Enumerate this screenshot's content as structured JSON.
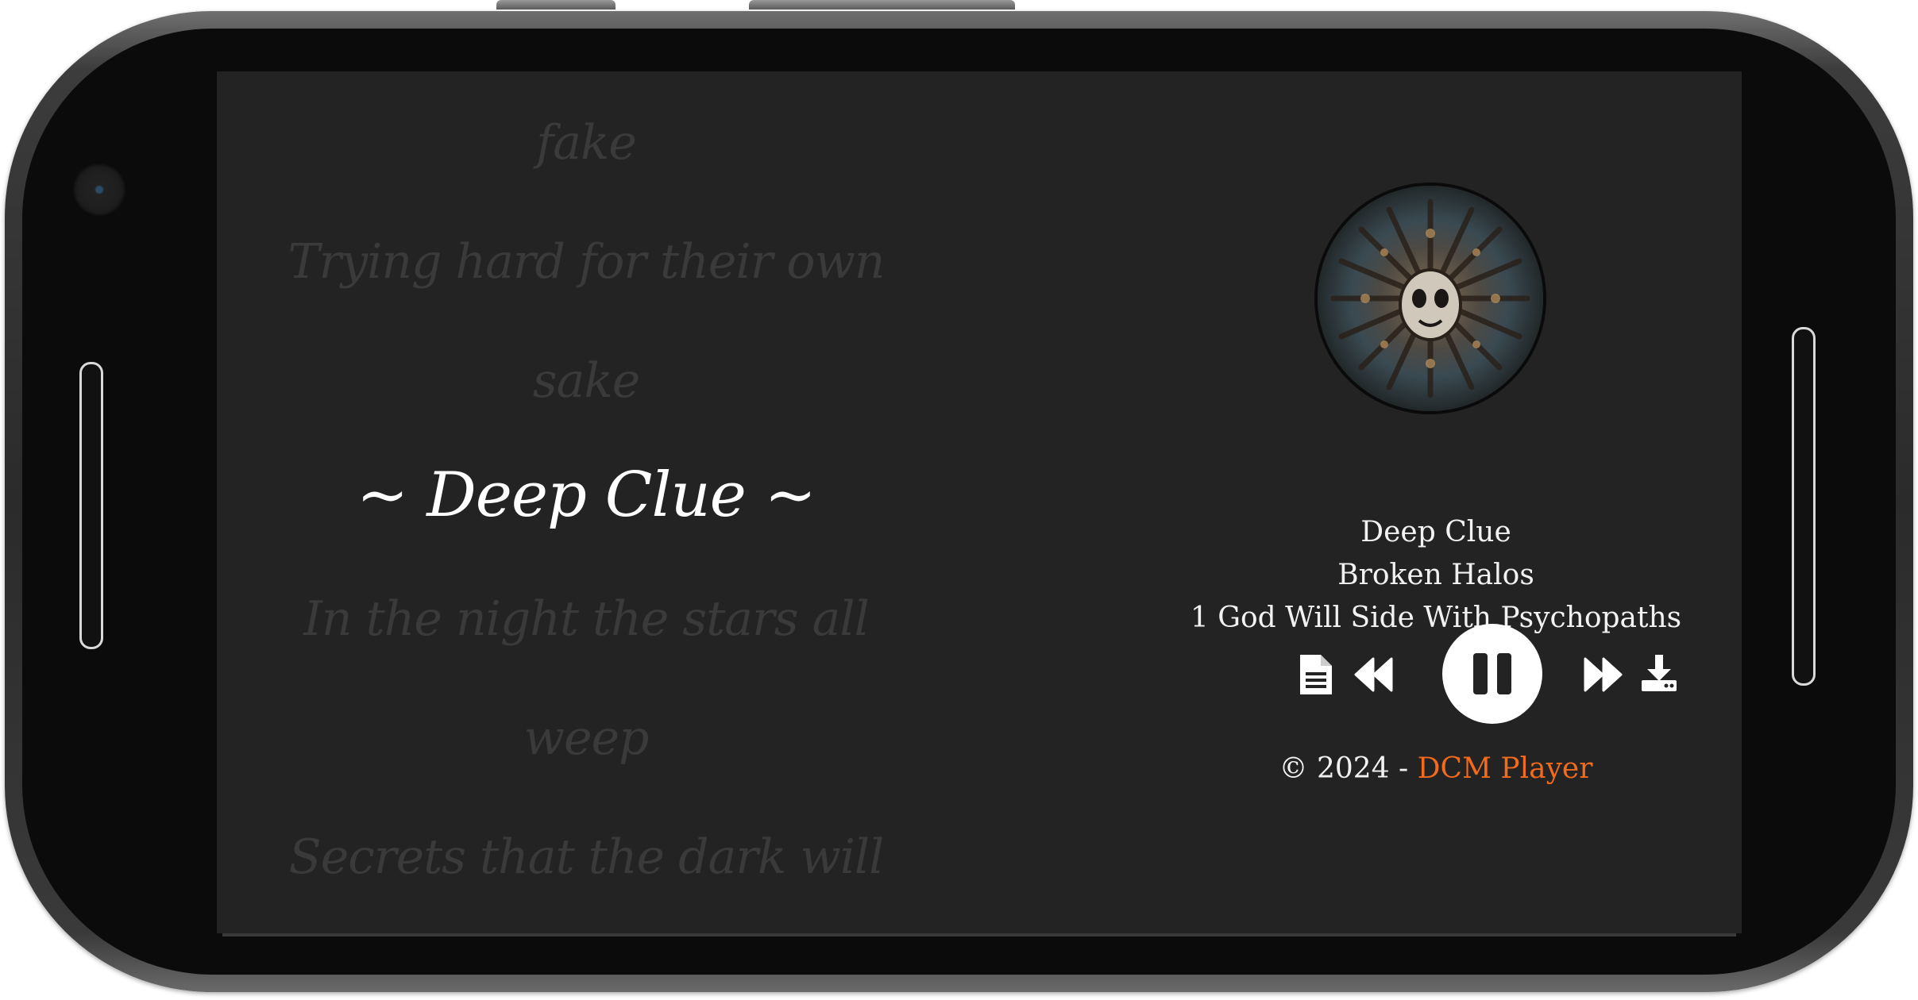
{
  "colors": {
    "screen_background": "#232323",
    "lyric_inactive": "#3a3a3a",
    "lyric_active": "#ffffff",
    "text": "#f2f2f2",
    "brand": "#f26a1b",
    "play_button": "#ffffff"
  },
  "lyrics": {
    "lines": [
      "fake",
      "Trying hard for their own",
      "sake",
      "~ Deep Clue ~",
      "In the night the stars all",
      "weep",
      "Secrets that the dark will"
    ],
    "active_index": 3
  },
  "track": {
    "title": "Deep Clue",
    "artist": "Broken Halos",
    "album": "1 God Will Side With Psychopaths",
    "cover_art": "album-cover-image",
    "is_playing": true
  },
  "controls": {
    "lyrics_icon": "document-icon",
    "previous_icon": "rewind-icon",
    "play_pause_icon": "pause-icon",
    "next_icon": "fast-forward-icon",
    "download_icon": "download-icon"
  },
  "footer": {
    "copyright": "© 2024 - ",
    "brand": "DCM Player"
  }
}
